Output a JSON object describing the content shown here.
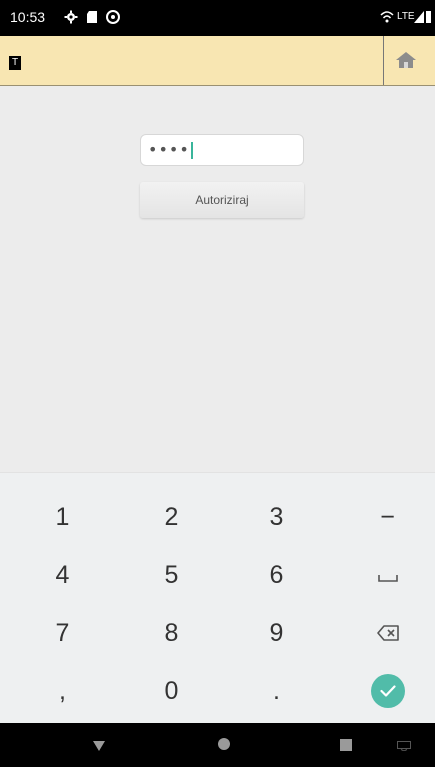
{
  "status_bar": {
    "time": "10:53",
    "network": "LTE"
  },
  "app_bar": {
    "logo_text": "T"
  },
  "login": {
    "password_value": "••••",
    "authorize_label": "Autoriziraj"
  },
  "keyboard": {
    "rows": [
      [
        "1",
        "2",
        "3",
        "−"
      ],
      [
        "4",
        "5",
        "6",
        "space"
      ],
      [
        "7",
        "8",
        "9",
        "backspace"
      ],
      [
        ",",
        "0",
        ".",
        "confirm"
      ]
    ]
  },
  "colors": {
    "app_bar_bg": "#f8e6b2",
    "confirm_accent": "#51bca9"
  }
}
